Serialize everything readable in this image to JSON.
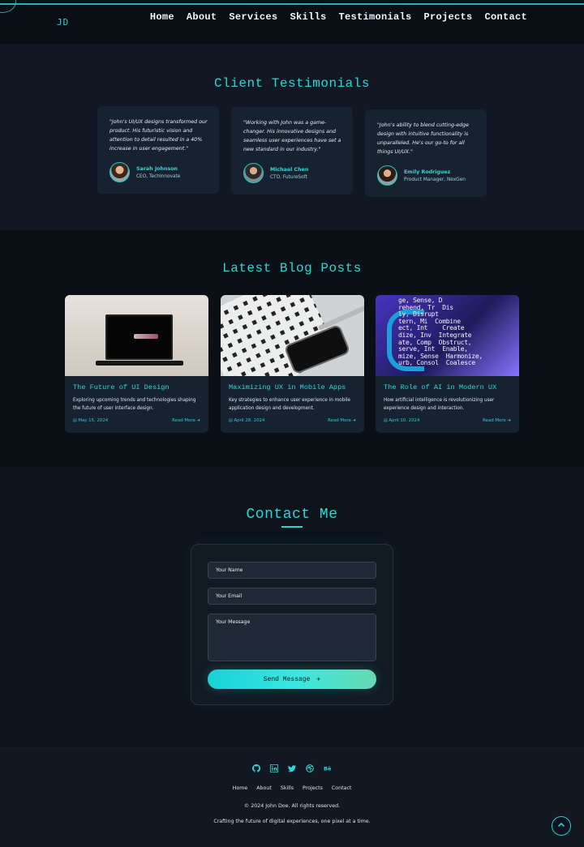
{
  "header": {
    "logo": "JD",
    "nav": [
      "Home",
      "About",
      "Services",
      "Skills",
      "Testimonials",
      "Projects",
      "Contact"
    ]
  },
  "testimonials": {
    "title": "Client Testimonials",
    "items": [
      {
        "quote": "\"John's UI/UX designs transformed our product. His futuristic vision and attention to detail resulted in a 40% increase in user engagement.\"",
        "name": "Sarah Johnson",
        "role": "CEO, TechInnovate"
      },
      {
        "quote": "\"Working with John was a game-changer. His innovative designs and seamless user experiences have set a new standard in our industry.\"",
        "name": "Michael Chen",
        "role": "CTO, FutureSoft"
      },
      {
        "quote": "\"John's ability to blend cutting-edge design with intuitive functionality is unparalleled. He's our go-to for all things UI/UX.\"",
        "name": "Emily Rodriguez",
        "role": "Product Manager, NexGen"
      }
    ]
  },
  "blog": {
    "title": "Latest Blog Posts",
    "posts": [
      {
        "title": "The Future of UI Design",
        "desc": "Exploring upcoming trends and technologies shaping the future of user interface design.",
        "date": "May 15, 2024",
        "more": "Read More"
      },
      {
        "title": "Maximizing UX in Mobile Apps",
        "desc": "Key strategies to enhance user experience in mobile application design and development.",
        "date": "April 28, 2024",
        "more": "Read More"
      },
      {
        "title": "The Role of AI in Modern UX",
        "desc": "How artificial intelligence is revolutionizing user experience design and interaction.",
        "date": "April 10, 2024",
        "more": "Read More"
      }
    ]
  },
  "contact": {
    "title": "Contact Me",
    "name_placeholder": "Your Name",
    "email_placeholder": "Your Email",
    "message_placeholder": "Your Message",
    "send_label": "Send Message"
  },
  "footer": {
    "socials": [
      "github-icon",
      "linkedin-icon",
      "twitter-icon",
      "dribbble-icon",
      "behance-icon"
    ],
    "nav": [
      "Home",
      "About",
      "Skills",
      "Projects",
      "Contact"
    ],
    "copyright": "© 2024 John Doe. All rights reserved.",
    "tagline": "Crafting the future of digital experiences, one pixel at a time."
  },
  "colors": {
    "accent": "#2ad8d6",
    "background": "#0c1118",
    "card": "#172230"
  }
}
